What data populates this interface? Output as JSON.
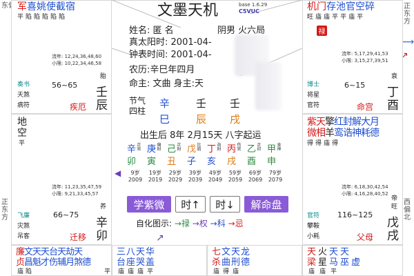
{
  "margins": {
    "left_top": "东偏南",
    "left_mid": "正东方",
    "right_top": "正东方",
    "right_bottom": "西偏北"
  },
  "cell_tl": {
    "stars": [
      "军",
      "喜",
      "姚",
      "使",
      "截",
      "宿"
    ],
    "brightness": [
      "平",
      "陷",
      "陷",
      "陷",
      "陷",
      "陷"
    ],
    "years": "流年: 12,24,36,48,60",
    "xiaoxian": "小限: 10,22,34,46,58",
    "boshi": "奏书",
    "god1": "天煞",
    "god2": "病符",
    "range": "56~65",
    "changsheng": "胎",
    "palace": "疾厄",
    "ganzhi": "壬辰"
  },
  "cell_tr": {
    "stars": [
      "机",
      "门",
      "存",
      "池",
      "官",
      "空",
      "碎"
    ],
    "brightness": [
      "旺",
      "庙",
      "庙",
      "平",
      "平",
      "庙",
      "平"
    ],
    "seal": "禄",
    "years": "流年: 5,17,29,41,53",
    "xiaoxian": "小限: 3,15,27,39,51",
    "boshi": "博士",
    "god1": "将星",
    "god2": "官符",
    "range": "6~15",
    "changsheng": "衰",
    "palace": "命宫",
    "ganzhi": "丁酉"
  },
  "cell_ml": {
    "star1": "地",
    "star2": "空",
    "bright": "平",
    "years": "流年: 11,23,35,47,59",
    "xiaoxian": "小限: 9,21,33,45,57",
    "boshi": "飞廉",
    "god1": "灾煞",
    "god2": "吊客",
    "range": "66~75",
    "changsheng": "养",
    "palace": "迁移",
    "ganzhi": "辛卯"
  },
  "cell_mr": {
    "row1": [
      "紫",
      "天",
      "擎",
      "红",
      "封",
      "解",
      "大",
      "月"
    ],
    "row2": [
      "微",
      "相",
      "羊",
      "鸾",
      "诰",
      "神",
      "耗",
      "德"
    ],
    "brightness": [
      "得",
      "得",
      "庙",
      "得"
    ],
    "years": "流年: 6,18,30,42,54",
    "xiaoxian": "小限: 4,16,28,40,52",
    "boshi": "官符",
    "god1": "攀鞍",
    "god2": "小耗",
    "range": "116~125",
    "changsheng_a": "帝",
    "changsheng_b": "旺",
    "palace": "父母",
    "ganzhi": "戊戌"
  },
  "bottom_left": {
    "row1": [
      "廉",
      "文",
      "天",
      "天",
      "台",
      "天",
      "劫",
      "天"
    ],
    "row2": [
      "贞",
      "昌",
      "魁",
      "才",
      "伤",
      "辅",
      "月",
      "煞",
      "德"
    ],
    "row3": [
      "庙",
      "陷",
      "",
      "",
      "",
      "",
      "",
      "平"
    ]
  },
  "bottom_mid1": {
    "row1": [
      "三",
      "八",
      "天",
      "华"
    ],
    "row2": [
      "台",
      "座",
      "哭",
      "盖"
    ],
    "row3": [
      "庙",
      "庙",
      "庙",
      "平"
    ]
  },
  "bottom_mid2": {
    "row1": [
      "七",
      "文",
      "天",
      "龙"
    ],
    "row2": [
      "杀",
      "曲",
      "刑",
      "德"
    ],
    "row3": [
      "庙",
      "得",
      "庙",
      ""
    ]
  },
  "bottom_right": {
    "row1": [
      "天",
      "火",
      "天",
      "天"
    ],
    "row2": [
      "梁",
      "星",
      "马",
      "巫",
      "虚"
    ],
    "row3": [
      "庙",
      "庙",
      "平",
      "",
      ""
    ]
  },
  "center": {
    "title": "文墨天机",
    "version": "base 1.6.29",
    "version_code": "C5VUC",
    "name_label": "姓名:",
    "name_value": "匿 名",
    "yinyang": "阴男 火六局",
    "solar_label": "真太阳时:",
    "solar_value": "2001-04-",
    "clock_label": "钟表时间:",
    "clock_value": "2001-04-",
    "lunar_label": "农历:",
    "lunar_value": "辛巳年四月",
    "ming_label": "命主:",
    "ming_value": "文曲 身主:天",
    "jieqi": "节气",
    "sizhu": "四柱",
    "pillars_top": [
      "辛",
      "壬",
      "壬"
    ],
    "pillars_bottom": [
      "巳",
      "辰",
      "戌"
    ],
    "qiyun": "出生后 8年 2月15天 八字起运",
    "dayun_small": [
      "正官",
      "偏财",
      "正财",
      "比肩",
      "劫财",
      "伤官",
      "正印",
      "食神"
    ],
    "dayun_top": [
      "辛",
      "庚",
      "己",
      "戊",
      "丁",
      "丙",
      "乙",
      "甲"
    ],
    "dayun_bottom": [
      "卯",
      "寅",
      "丑",
      "子",
      "亥",
      "戌",
      "酉",
      "申"
    ],
    "ages": [
      "9岁",
      "19岁",
      "29岁",
      "39岁",
      "49岁",
      "59岁",
      "69岁",
      "79岁"
    ],
    "years": [
      "2009",
      "2019",
      "2029",
      "2039",
      "2049",
      "2059",
      "2069",
      "2079"
    ],
    "btn_xueziwei": "学紫微",
    "btn_time_up": "时↑",
    "btn_time_down": "时↓",
    "btn_jieming": "解命盘",
    "sihua_label": "自化图示:",
    "sihua_lu": "→禄",
    "sihua_quan": "→权",
    "sihua_ke": "→科",
    "sihua_ji": "→忌"
  },
  "colors": {
    "accent": "#8a5bd6",
    "red": "#d21a1a",
    "blue": "#1f4fd1",
    "green": "#2b8a3e"
  }
}
